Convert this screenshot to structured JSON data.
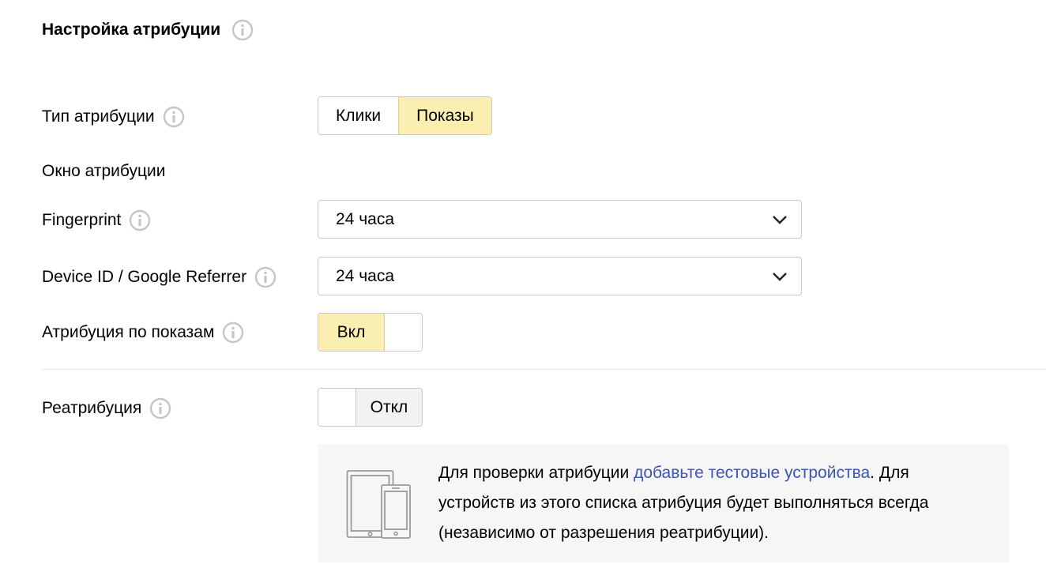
{
  "page": {
    "title": "Настройка атрибуции"
  },
  "attribution_type": {
    "label": "Тип атрибуции",
    "options": [
      "Клики",
      "Показы"
    ],
    "selected": "Показы"
  },
  "attribution_window": {
    "label": "Окно атрибуции"
  },
  "fingerprint": {
    "label": "Fingerprint",
    "value": "24 часа"
  },
  "device_id": {
    "label": "Device ID / Google Referrer",
    "value": "24 часа"
  },
  "impression_attribution": {
    "label": "Атрибуция по показам",
    "state_label": "Вкл"
  },
  "reattribution": {
    "label": "Реатрибуция",
    "state_label": "Откл"
  },
  "notice": {
    "text_before": "Для проверки атрибуции ",
    "link_text": "добавьте тестовые устройства",
    "text_after": ". Для устройств из этого списка атрибуция будет выполняться всегда (независимо от разрешения реатрибуции)."
  },
  "colors": {
    "active_bg": "#fbeeb1",
    "link": "#3b55b5",
    "notice_bg": "#f6f6f6"
  },
  "icons": [
    "info-icon",
    "chevron-down-icon",
    "devices-icon"
  ]
}
